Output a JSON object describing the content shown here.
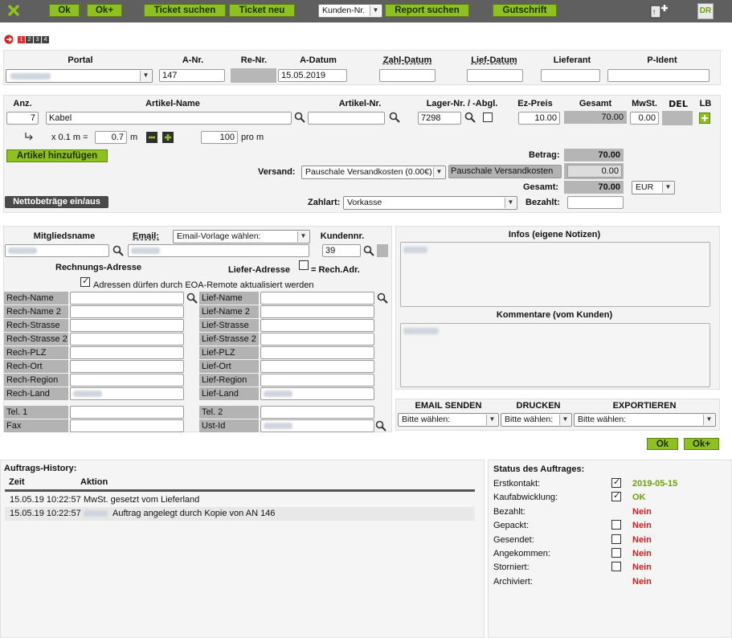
{
  "toolbar": {
    "ok": "Ok",
    "ok_plus": "Ok+",
    "ticket_suchen": "Ticket suchen",
    "ticket_neu": "Ticket neu",
    "kunden_select": "Kunden-Nr.",
    "report_suchen": "Report suchen",
    "gutschrift": "Gutschrift",
    "dr_badge": "DR"
  },
  "pages": [
    "1",
    "2",
    "3",
    "4"
  ],
  "order_header": {
    "cols": [
      "Portal",
      "A-Nr.",
      "Re-Nr.",
      "A-Datum",
      "Zahl-Datum",
      "Lief-Datum",
      "Lieferant",
      "P-Ident"
    ],
    "a_nr": "147",
    "a_datum": "15.05.2019"
  },
  "items": {
    "cols": [
      "Anz.",
      "Artikel-Name",
      "Artikel-Nr.",
      "Lager-Nr. / -Abgl.",
      "Ez-Preis",
      "Gesamt",
      "MwSt.",
      "DEL",
      "LB"
    ],
    "row": {
      "anz": "7",
      "name": "Kabel",
      "lager": "7298",
      "ez_preis": "10.00",
      "gesamt": "70.00",
      "mwst": "0.00"
    },
    "unit_prefix": "x 0.1 m =",
    "unit_value": "0.7",
    "unit_suffix": "m",
    "pro_value": "100",
    "pro_suffix": "pro m",
    "add_button": "Artikel hinzufügen",
    "netto_button": "Nettobeträge ein/aus"
  },
  "totals": {
    "betrag_label": "Betrag:",
    "betrag": "70.00",
    "versand_label": "Versand:",
    "versand_select": "Pauschale Versandkosten (0.00€)",
    "versand_name": "Pauschale Versandkosten",
    "versand_value": "0.00",
    "gesamt_label": "Gesamt:",
    "gesamt": "70.00",
    "currency": "EUR",
    "zahlart_label": "Zahlart:",
    "zahlart": "Vorkasse",
    "bezahlt_label": "Bezahlt:"
  },
  "customer": {
    "mitgliedsname": "Mitgliedsname",
    "email_label": "Email:",
    "email_select": "Email-Vorlage wählen:",
    "kundennr_label": "Kundennr.",
    "kundennr": "39",
    "rechnung": "Rechnungs-Adresse",
    "liefer": "Liefer-Adresse",
    "rech_adr": "= Rech.Adr.",
    "remote": "Adressen dürfen durch EOA-Remote aktualisiert werden",
    "rech_fields": [
      "Rech-Name",
      "Rech-Name 2",
      "Rech-Strasse",
      "Rech-Strasse 2",
      "Rech-PLZ",
      "Rech-Ort",
      "Rech-Region",
      "Rech-Land"
    ],
    "lief_fields": [
      "Lief-Name",
      "Lief-Name 2",
      "Lief-Strasse",
      "Lief-Strasse 2",
      "Lief-PLZ",
      "Lief-Ort",
      "Lief-Region",
      "Lief-Land"
    ],
    "tel1": "Tel. 1",
    "fax": "Fax",
    "tel2": "Tel. 2",
    "ustid": "Ust-Id"
  },
  "notes": {
    "infos": "Infos (eigene Notizen)",
    "kommentare": "Kommentare (vom Kunden)"
  },
  "actions": {
    "email_senden": "EMAIL SENDEN",
    "drucken": "DRUCKEN",
    "exportieren": "EXPORTIEREN",
    "select": "Bitte wählen:",
    "ok": "Ok",
    "ok_plus": "Ok+"
  },
  "history": {
    "title": "Auftrags-History:",
    "col_zeit": "Zeit",
    "col_aktion": "Aktion",
    "rows": [
      {
        "zeit": "15.05.19 10:22:57",
        "aktion": "MwSt. gesetzt vom Lieferland"
      },
      {
        "zeit": "15.05.19 10:22:57",
        "aktion": "Auftrag angelegt durch Kopie von AN 146"
      }
    ]
  },
  "status": {
    "title": "Status des Auftrages:",
    "rows": [
      {
        "label": "Erstkontakt:",
        "value": "2019-05-15",
        "check": "checked"
      },
      {
        "label": "Kaufabwicklung:",
        "value": "OK",
        "check": "checked"
      },
      {
        "label": "Bezahlt:",
        "value": "Nein",
        "check": "none"
      },
      {
        "label": "Gepackt:",
        "value": "Nein",
        "check": "empty"
      },
      {
        "label": "Gesendet:",
        "value": "Nein",
        "check": "empty"
      },
      {
        "label": "Angekommen:",
        "value": "Nein",
        "check": "empty"
      },
      {
        "label": "Storniert:",
        "value": "Nein",
        "check": "empty"
      },
      {
        "label": "Archiviert:",
        "value": "Nein",
        "check": "none"
      }
    ]
  }
}
